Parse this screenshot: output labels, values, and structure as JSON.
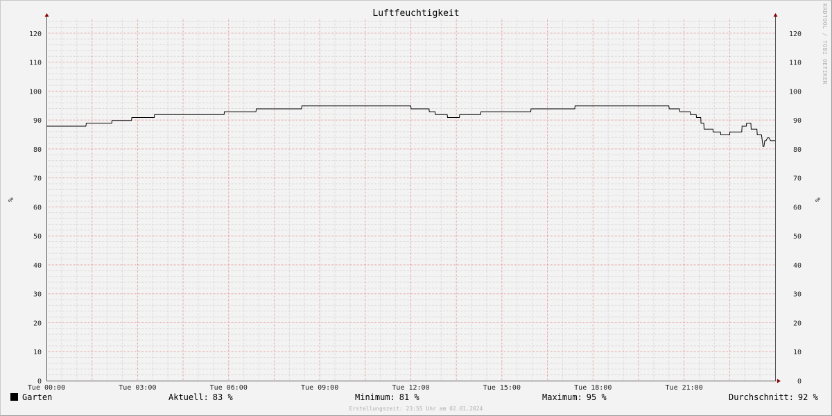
{
  "chart_data": {
    "type": "line",
    "title": "Luftfeuchtigkeit",
    "ylabel_left": "%",
    "ylabel_right": "%",
    "ylim": [
      0,
      125
    ],
    "y_ticks": [
      0,
      10,
      20,
      30,
      40,
      50,
      60,
      70,
      80,
      90,
      100,
      110,
      120
    ],
    "x_ticks": [
      "Tue 00:00",
      "Tue 03:00",
      "Tue 06:00",
      "Tue 09:00",
      "Tue 12:00",
      "Tue 15:00",
      "Tue 18:00",
      "Tue 21:00"
    ],
    "x_range_hours": [
      0,
      24
    ],
    "grid": true,
    "series": [
      {
        "name": "Garten",
        "color": "#000000",
        "x_hours": [
          0,
          1.3,
          1.31,
          2.15,
          2.16,
          2.8,
          2.81,
          3.55,
          3.56,
          5.85,
          5.86,
          6.9,
          6.91,
          8.4,
          8.41,
          12.0,
          12.01,
          12.6,
          12.61,
          12.8,
          12.81,
          13.2,
          13.21,
          13.6,
          13.61,
          14.3,
          14.31,
          15.95,
          15.96,
          17.4,
          17.41,
          20.5,
          20.51,
          20.85,
          20.86,
          21.2,
          21.21,
          21.4,
          21.41,
          21.55,
          21.56,
          21.65,
          21.66,
          21.95,
          21.96,
          22.2,
          22.21,
          22.5,
          22.51,
          22.9,
          22.91,
          23.05,
          23.06,
          23.2,
          23.21,
          23.4,
          23.41,
          23.55,
          23.6,
          23.63,
          23.66,
          23.7,
          23.75,
          23.8,
          23.85,
          24.0
        ],
        "values": [
          88,
          88,
          89,
          89,
          90,
          90,
          91,
          91,
          92,
          92,
          93,
          93,
          94,
          94,
          95,
          95,
          94,
          94,
          93,
          93,
          92,
          92,
          91,
          91,
          92,
          92,
          93,
          93,
          94,
          94,
          95,
          95,
          94,
          94,
          93,
          93,
          92,
          92,
          91,
          91,
          89,
          89,
          87,
          87,
          86,
          86,
          85,
          85,
          86,
          86,
          88,
          88,
          89,
          89,
          87,
          87,
          85,
          85,
          81,
          81,
          83,
          83,
          84,
          84,
          83,
          83
        ]
      }
    ],
    "color_accent": "#8b0000",
    "grid_major_color": "#e49b9b",
    "grid_minor_color": "#d6d6d6"
  },
  "legend": {
    "series_name": "Garten",
    "current_label": "Aktuell:",
    "current_value": "83 %",
    "min_label": "Minimum:",
    "min_value": "81 %",
    "max_label": "Maximum:",
    "max_value": "95 %",
    "avg_label": "Durchschnitt:",
    "avg_value": "92 %"
  },
  "watermark": "RRDTOOL / TOBI OETIKER",
  "footer": "Erstellungszeit: 23:55 Uhr am 02.01.2024"
}
